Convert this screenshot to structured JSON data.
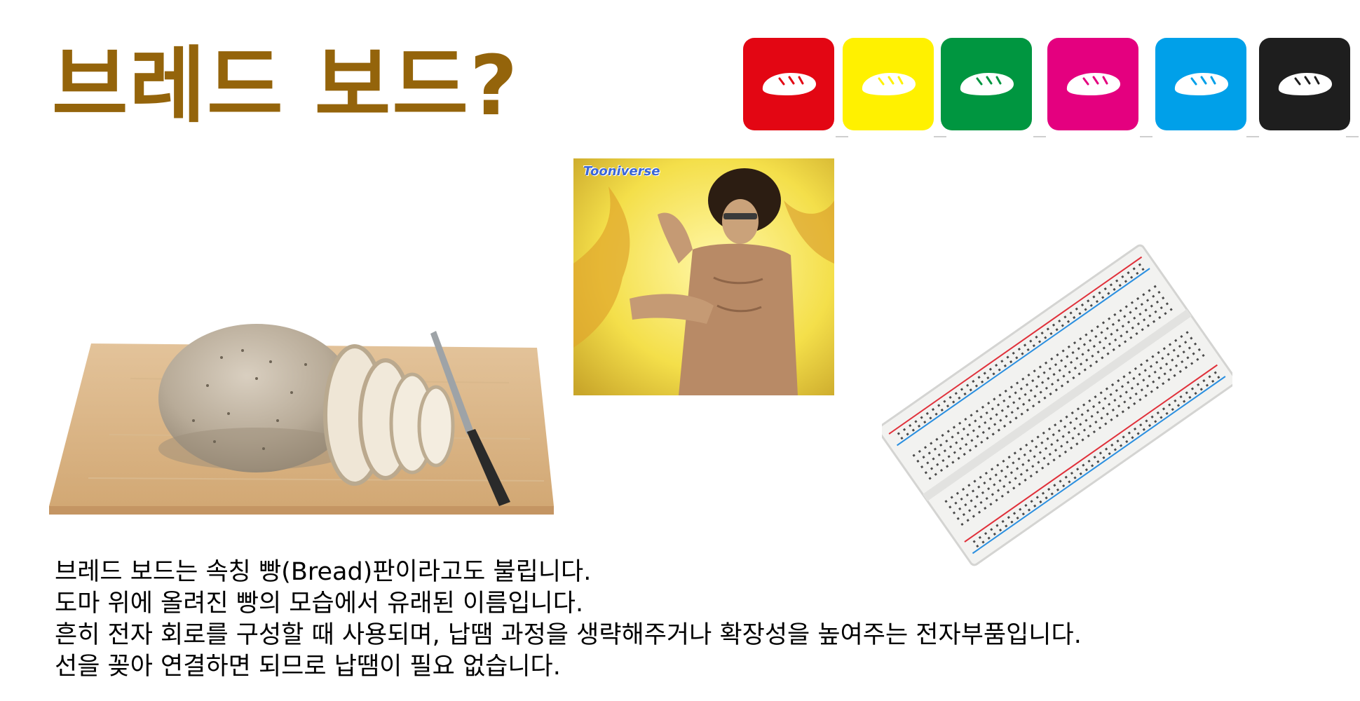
{
  "slide": {
    "title": "브레드 보드?",
    "title_color": "#94640b",
    "icon_tiles": [
      {
        "color": "#e30613",
        "icon": "bread-loaf-icon"
      },
      {
        "color": "#fff100",
        "icon": "bread-loaf-icon"
      },
      {
        "color": "#009640",
        "icon": "bread-loaf-icon"
      },
      {
        "color": "#e4007f",
        "icon": "bread-loaf-icon"
      },
      {
        "color": "#00a0e9",
        "icon": "bread-loaf-icon"
      },
      {
        "color": "#1e1e1e",
        "icon": "bread-loaf-icon"
      }
    ],
    "images": {
      "bread": "bread-on-cutting-board-photo",
      "anime": "anime-martial-artist-image",
      "breadboard": "electronic-breadboard-photo"
    },
    "anime_watermark": "Tooniverse",
    "body_lines": [
      "브레드 보드는 속칭 빵(Bread)판이라고도 불립니다.",
      "도마 위에 올려진 빵의 모습에서 유래된 이름입니다.",
      "흔히 전자 회로를 구성할 때 사용되며, 납땜 과정을 생략해주거나 확장성을 높여주는 전자부품입니다.",
      "선을 꽂아 연결하면 되므로 납땜이 필요 없습니다."
    ]
  }
}
